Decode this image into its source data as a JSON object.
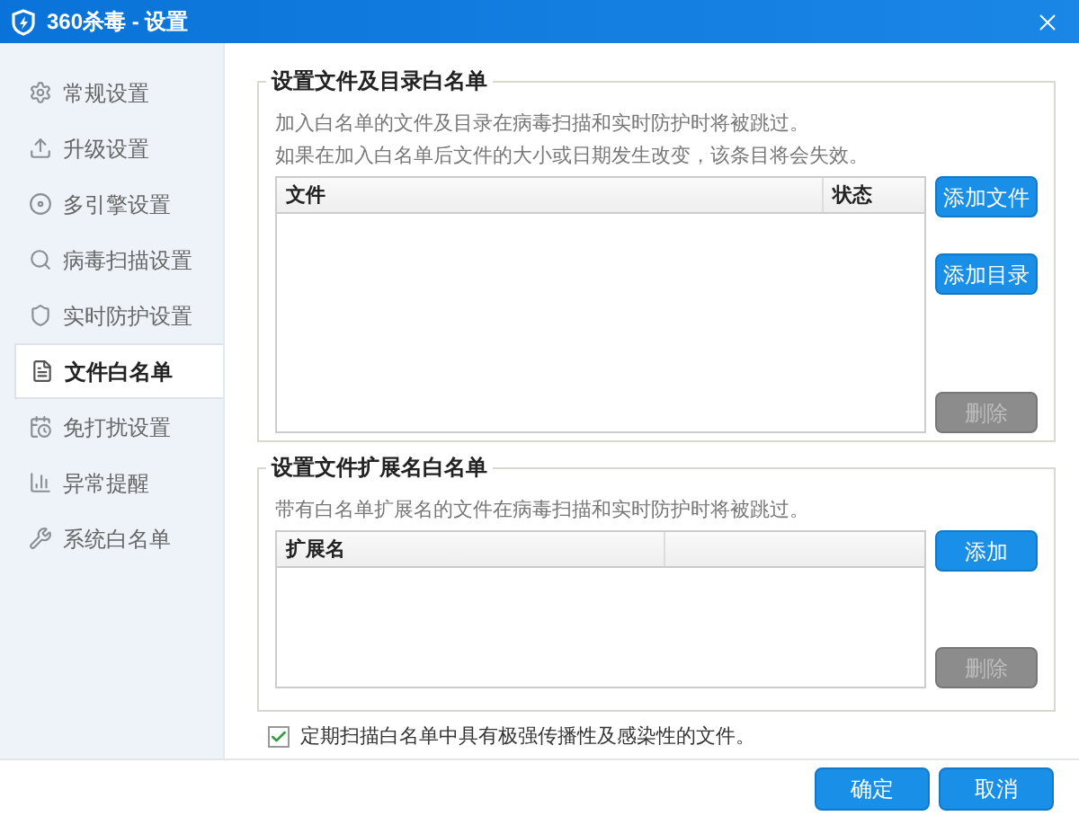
{
  "window": {
    "title": "360杀毒 - 设置"
  },
  "sidebar": {
    "items": [
      {
        "label": "常规设置",
        "selected": false
      },
      {
        "label": "升级设置",
        "selected": false
      },
      {
        "label": "多引擎设置",
        "selected": false
      },
      {
        "label": "病毒扫描设置",
        "selected": false
      },
      {
        "label": "实时防护设置",
        "selected": false
      },
      {
        "label": "文件白名单",
        "selected": true
      },
      {
        "label": "免打扰设置",
        "selected": false
      },
      {
        "label": "异常提醒",
        "selected": false
      },
      {
        "label": "系统白名单",
        "selected": false
      }
    ]
  },
  "groups": [
    {
      "title": "设置文件及目录白名单",
      "description": [
        "加入白名单的文件及目录在病毒扫描和实时防护时将被跳过。",
        "如果在加入白名单后文件的大小或日期发生改变，该条目将会失效。"
      ],
      "columns": [
        "文件",
        "状态"
      ],
      "buttons": [
        {
          "label": "添加文件",
          "disabled": false
        },
        {
          "label": "添加目录",
          "disabled": false
        },
        {
          "label": "删除",
          "disabled": true
        }
      ]
    },
    {
      "title": "设置文件扩展名白名单",
      "description": [
        "带有白名单扩展名的文件在病毒扫描和实时防护时将被跳过。"
      ],
      "columns": [
        "扩展名"
      ],
      "buttons": [
        {
          "label": "添加",
          "disabled": false
        },
        {
          "label": "删除",
          "disabled": true
        }
      ]
    }
  ],
  "option": {
    "label": "定期扫描白名单中具有极强传播性及感染性的文件。",
    "checked": true
  },
  "footer": {
    "buttons": [
      "确定",
      "取消"
    ]
  }
}
